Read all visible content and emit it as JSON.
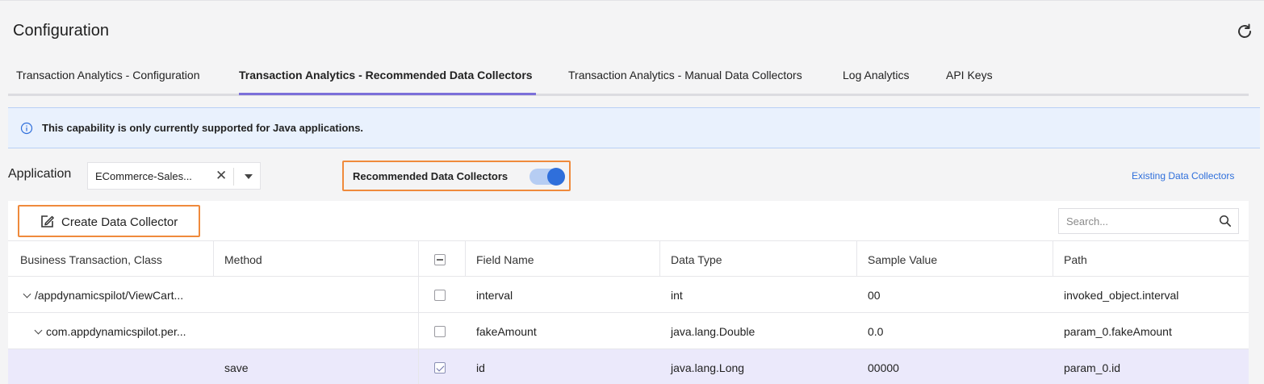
{
  "header": {
    "title": "Configuration",
    "refresh_icon": "refresh-icon"
  },
  "tabs": [
    {
      "label": "Transaction Analytics - Configuration",
      "active": false
    },
    {
      "label": "Transaction Analytics - Recommended Data Collectors",
      "active": true
    },
    {
      "label": "Transaction Analytics - Manual Data Collectors",
      "active": false
    },
    {
      "label": "Log Analytics",
      "active": false
    },
    {
      "label": "API Keys",
      "active": false
    }
  ],
  "notice": {
    "icon": "info-icon",
    "text": "This capability is only currently supported for Java applications."
  },
  "filters": {
    "application_label": "Application",
    "application_value": "ECommerce-Sales...",
    "clear_glyph": "✕",
    "recommended_label": "Recommended Data Collectors",
    "recommended_enabled": true,
    "existing_link": "Existing Data Collectors"
  },
  "toolbar": {
    "create_label": "Create Data Collector",
    "create_icon": "edit-icon",
    "search_placeholder": "Search..."
  },
  "table": {
    "columns": [
      "Business Transaction, Class",
      "Method",
      "",
      "Field Name",
      "Data Type",
      "Sample Value",
      "Path"
    ],
    "rows": [
      {
        "bt": "/appdynamicspilot/ViewCart...",
        "method": "",
        "checked": false,
        "field": "interval",
        "type": "int",
        "sample": "00",
        "path": "invoked_object.interval"
      },
      {
        "bt": "com.appdynamicspilot.per...",
        "method": "",
        "checked": false,
        "field": "fakeAmount",
        "type": "java.lang.Double",
        "sample": "0.0",
        "path": "param_0.fakeAmount"
      },
      {
        "bt": "",
        "method": "save",
        "checked": true,
        "field": "id",
        "type": "java.lang.Long",
        "sample": "00000",
        "path": "param_0.id"
      }
    ]
  },
  "colors": {
    "accent": "#7b6fd9",
    "highlight_box": "#ef8a3c",
    "link": "#2f6fdb",
    "selected_row": "#ebe9fb",
    "notice_bg": "#e9f1fd"
  }
}
